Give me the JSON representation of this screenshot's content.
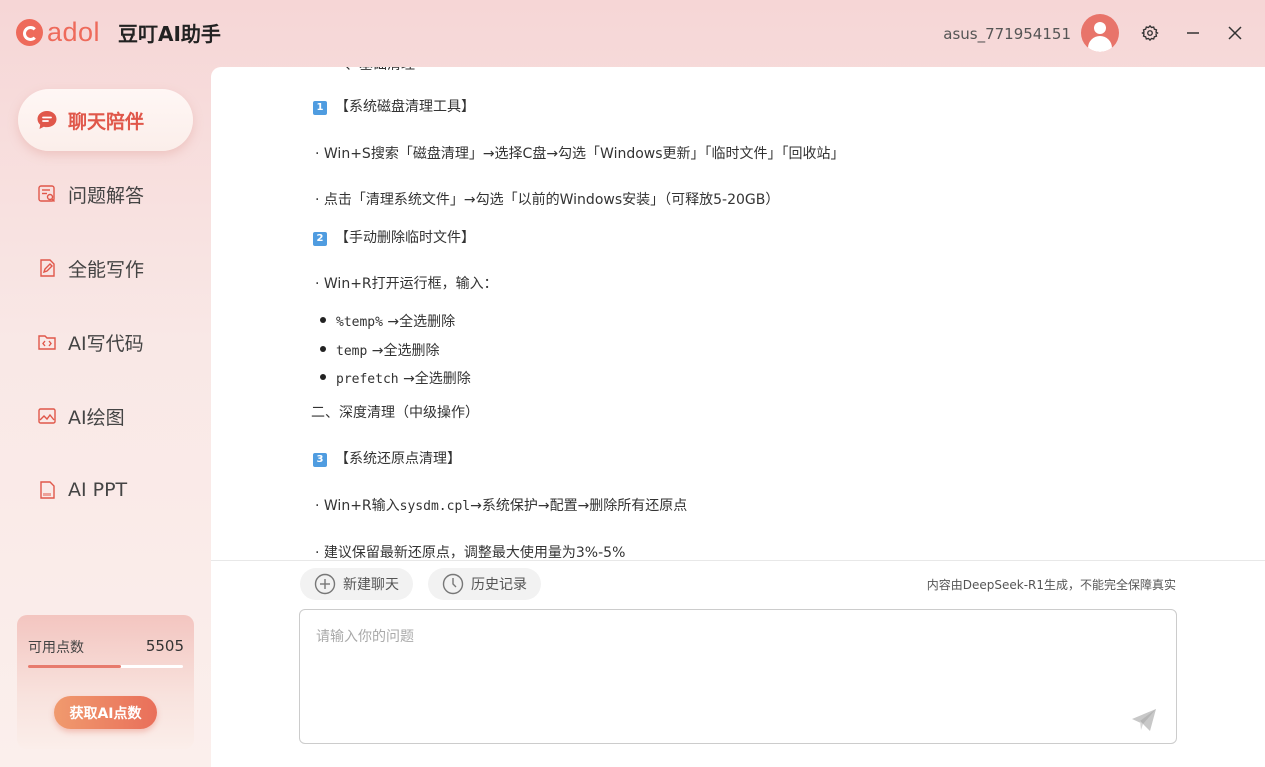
{
  "header": {
    "logo_text": "adol",
    "app_title": "豆叮AI助手",
    "username": "asus_771954151"
  },
  "sidebar": {
    "items": [
      {
        "label": "聊天陪伴",
        "icon": "chat-bubble-icon",
        "active": true
      },
      {
        "label": "问题解答",
        "icon": "qa-document-icon",
        "active": false
      },
      {
        "label": "全能写作",
        "icon": "pen-document-icon",
        "active": false
      },
      {
        "label": "AI写代码",
        "icon": "code-folder-icon",
        "active": false
      },
      {
        "label": "AI绘图",
        "icon": "picture-icon",
        "active": false
      },
      {
        "label": "AI PPT",
        "icon": "ppt-file-icon",
        "active": false
      }
    ],
    "points": {
      "label": "可用点数",
      "value": "5505",
      "fill_fraction": 0.6,
      "button_label": "获取AI点数"
    }
  },
  "content": {
    "top_partial": "一、基础清理",
    "s1_num": "1",
    "s1_title": "【系统磁盘清理工具】",
    "s1_l1": "· Win+S搜索「磁盘清理」→选择C盘→勾选「Windows更新」「临时文件」「回收站」",
    "s1_l2": "· 点击「清理系统文件」→勾选「以前的Windows安装」（可释放5-20GB）",
    "s2_num": "2",
    "s2_title": "【手动删除临时文件】",
    "s2_l1": "· Win+R打开运行框，输入：",
    "bullets": [
      {
        "code": "%temp%",
        "text": "→全选删除"
      },
      {
        "code": "temp",
        "text": "→全选删除"
      },
      {
        "code": "prefetch",
        "text": "→全选删除"
      }
    ],
    "section2": "二、深度清理（中级操作）",
    "s3_num": "3",
    "s3_title": "【系统还原点清理】",
    "s3_l1_pre": "· Win+R输入",
    "s3_l1_code": "sysdm.cpl",
    "s3_l1_post": "→系统保护→配置→删除所有还原点",
    "s3_l2": "· 建议保留最新还原点，调整最大使用量为3%-5%"
  },
  "actions": {
    "new_chat": "新建聊天",
    "history": "历史记录",
    "disclaimer": "内容由DeepSeek-R1生成，不能完全保障真实"
  },
  "input": {
    "placeholder": "请输入你的问题"
  },
  "colors": {
    "accent": "#e0574a",
    "badge_blue": "#4f9ce0"
  }
}
